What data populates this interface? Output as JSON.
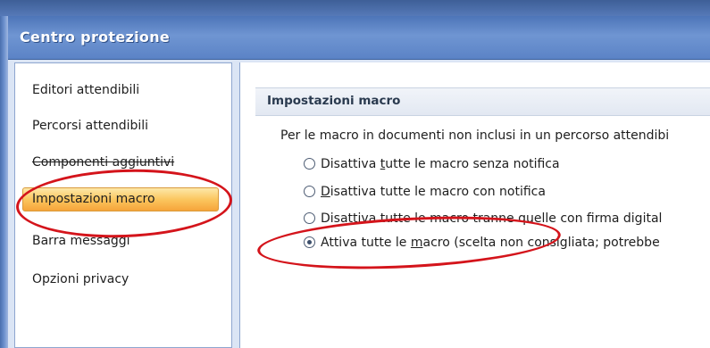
{
  "window": {
    "title": "Centro protezione"
  },
  "nav": {
    "items": [
      {
        "label": "Editori attendibili"
      },
      {
        "label": "Percorsi attendibili"
      },
      {
        "label": "Componenti aggiuntivi"
      },
      {
        "label": "Impostazioni macro",
        "selected": true
      },
      {
        "label": "Barra messaggi"
      },
      {
        "label": "Opzioni privacy"
      }
    ]
  },
  "main": {
    "section_title": "Impostazioni macro",
    "intro": "Per le macro in documenti non inclusi in un percorso attendibi",
    "options": [
      {
        "pre": "Disattiva ",
        "u": "t",
        "post": "utte le macro senza notifica",
        "checked": false
      },
      {
        "pre": "",
        "u": "D",
        "post": "isattiva tutte le macro con notifica",
        "checked": false
      },
      {
        "pre": "Disa",
        "u": "t",
        "post": "tiva tutte le macro tranne quelle con firma digital",
        "checked": false
      },
      {
        "pre": "Attiva tutte le ",
        "u": "m",
        "post": "acro (scelta non consigliata; potrebbe",
        "checked": true
      }
    ]
  },
  "annotation_color": "#d4141b"
}
